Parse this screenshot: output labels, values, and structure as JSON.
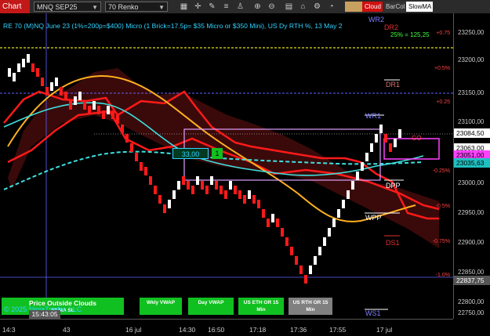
{
  "toolbar": {
    "chart_tab": "Chart",
    "instrument": "MNQ SEP25",
    "period": "70 Renko",
    "icons": [
      "grid-icon",
      "crosshair-icon",
      "draw-icon",
      "properties-icon",
      "strategy-icon",
      "zoom-in-icon",
      "zoom-out-icon",
      "layout-icon",
      "lock-icon"
    ],
    "indicators": [
      "Cloud",
      "BarCol",
      "SlowMA"
    ],
    "indicator_colors": [
      "#d01010",
      "#333333",
      "#ffffff"
    ],
    "indicator_text_colors": [
      "#ffffff",
      "#cccccc",
      "#000000"
    ]
  },
  "chart": {
    "title": "RE 70 (M)NQ June 23 (1%=200p=$400) Micro (1 Brick=17.5p= $35 Micro or $350 Mini), US Dy RTH %, 13 May 2",
    "change_text": "25% = 125,25",
    "levels": {
      "wr2": "WR2",
      "dr2": "DR2",
      "dr1": "DR1",
      "wr1": "WR1",
      "dpp": "DPP",
      "wpp": "WPP",
      "ds1": "DS1",
      "ws1": "WS1",
      "go": "GO"
    },
    "pct_labels": [
      "+0.75",
      "+0.5%",
      "+0.25",
      "-0.25%",
      "-0.5%",
      "-0.75%",
      "-1.0%"
    ],
    "value_box": "33,00",
    "value_box2": "1",
    "crosshair_time": "15:43:05",
    "copyright": "© 2025 NinjaTrader, LLC",
    "buttons": [
      {
        "label": "Price Outside Clouds",
        "sub": "F3 MA SL",
        "color": "#10c020"
      },
      {
        "label": "Wkly VWAP",
        "sub": "",
        "color": "#10c020"
      },
      {
        "label": "Day VWAP",
        "sub": "",
        "color": "#10c020"
      },
      {
        "label": "US ETH OR 15",
        "sub": "Min",
        "color": "#10c020"
      },
      {
        "label": "US RTH OR 15",
        "sub": "Min",
        "color": "#808080"
      }
    ]
  },
  "yaxis": {
    "labels": [
      "23250,00",
      "23200,00",
      "23150,00",
      "23100,00",
      "23000,00",
      "22950,00",
      "22900,00",
      "22850,00",
      "22800,00",
      "22750,00"
    ],
    "price_boxes": [
      {
        "value": "23084,50",
        "bg": "#ffffff",
        "fg": "#000000"
      },
      {
        "value": "23063,00",
        "bg": "#ffffff",
        "fg": "#000000"
      },
      {
        "value": "23051,00",
        "bg": "#ff40ff",
        "fg": "#000000"
      },
      {
        "value": "23035,63",
        "bg": "#20c0c0",
        "fg": "#000000"
      },
      {
        "value": "22837,75",
        "bg": "#555555",
        "fg": "#ffffff"
      }
    ]
  },
  "xaxis": {
    "labels": [
      "14:3",
      "43",
      "16 jul",
      "14:30",
      "16:50",
      "17:18",
      "17:36",
      "17:55",
      "17 jul"
    ]
  }
}
